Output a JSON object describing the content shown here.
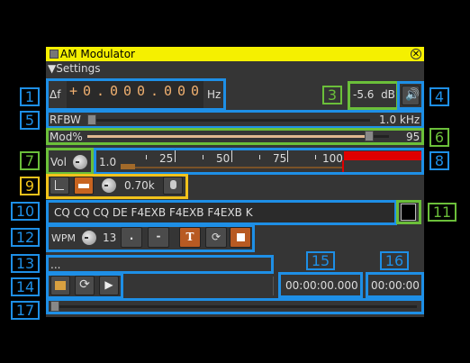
{
  "window": {
    "title": "AM Modulator",
    "settings_label": "Settings"
  },
  "freq": {
    "delta_label": "Δf",
    "sign": "+",
    "digits": [
      "0",
      ".",
      "0",
      "0",
      "0",
      ".",
      "0",
      "0",
      "0"
    ],
    "unit": "Hz"
  },
  "level": {
    "value": "-5.6",
    "unit": "dB"
  },
  "rfbw": {
    "label": "RFBW",
    "value": "1.0 kHz",
    "fraction": 0.02
  },
  "mod": {
    "label": "Mod%",
    "value": "95",
    "fraction": 0.95
  },
  "volume": {
    "label": "Vol",
    "first": "1.0",
    "ticks": [
      "25",
      "50",
      "75",
      "100"
    ],
    "level_fraction": 0.95
  },
  "tone": {
    "freq": "0.70k"
  },
  "morse": {
    "text": "CQ CQ CQ DE F4EXB F4EXB F4EXB K",
    "wpm_label": "WPM",
    "wpm": "13",
    "dot": ".",
    "dash": "-",
    "text_button": "T"
  },
  "file": {
    "name": "..."
  },
  "timing": {
    "elapsed": "00:00:00.000",
    "total": "00:00:00"
  },
  "callouts": [
    "1",
    "2",
    "3",
    "4",
    "5",
    "6",
    "7",
    "8",
    "9",
    "10",
    "11",
    "12",
    "13",
    "14",
    "15",
    "16",
    "17"
  ],
  "colors": {
    "title_bar": "#f5f000",
    "blue_callout": "#1e8fe6",
    "green_callout": "#6bbf3a",
    "yellow_callout": "#f1c21b",
    "meter_red": "#e00000"
  }
}
